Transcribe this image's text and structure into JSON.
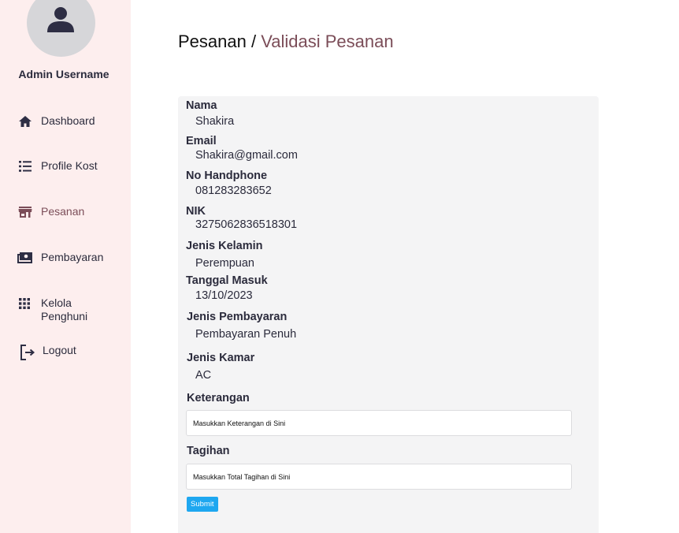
{
  "sidebar": {
    "admin_name": "Admin Username",
    "items": [
      {
        "label": "Dashboard",
        "icon": "home-icon"
      },
      {
        "label": "Profile Kost",
        "icon": "list-icon"
      },
      {
        "label": "Pesanan",
        "icon": "store-icon",
        "active": true
      },
      {
        "label": "Pembayaran",
        "icon": "money-icon"
      },
      {
        "label": "Kelola Penghuni",
        "icon": "grid-icon"
      },
      {
        "label": "Logout",
        "icon": "logout-icon"
      }
    ]
  },
  "breadcrumb": {
    "parent": "Pesanan",
    "separator": " / ",
    "current": "Validasi Pesanan"
  },
  "details": [
    {
      "label": "Nama",
      "value": "Shakira"
    },
    {
      "label": "Email",
      "value": "Shakira@gmail.com"
    },
    {
      "label": "No Handphone",
      "value": "081283283652"
    },
    {
      "label": "NIK",
      "value": "3275062836518301"
    },
    {
      "label": "Jenis Kelamin",
      "value": "Perempuan"
    },
    {
      "label": "Tanggal Masuk",
      "value": "13/10/2023"
    },
    {
      "label": "Jenis Pembayaran",
      "value": "Pembayaran Penuh"
    },
    {
      "label": "Jenis Kamar",
      "value": "AC"
    }
  ],
  "form": {
    "keterangan_label": "Keterangan",
    "keterangan_placeholder": "Masukkan Keterangan di Sini",
    "tagihan_label": "Tagihan",
    "tagihan_placeholder": "Masukkan Total Tagihan di Sini",
    "submit_label": "Submit"
  },
  "colors": {
    "sidebar_bg": "#fdeeee",
    "accent": "#7b4d58",
    "panel_bg": "#f4f4f5",
    "button": "#1ea7f0"
  }
}
